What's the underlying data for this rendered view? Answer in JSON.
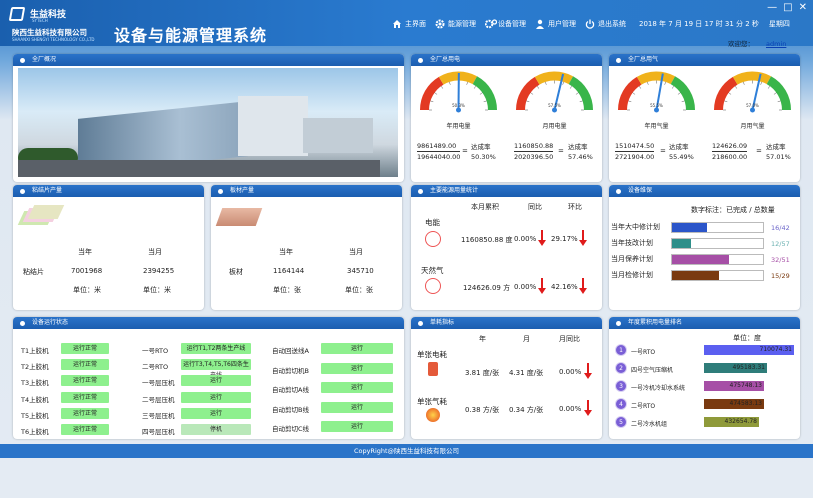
{
  "header": {
    "brand": "生益科技",
    "brand_en": "SYTECH",
    "company": "陕西生益科技有限公司",
    "company_en": "SHAANXI SHENGYI TECHNOLOGY CO.,LTD",
    "system_title": "设备与能源管理系统",
    "nav": [
      {
        "label": "主界面",
        "icon": "home-icon"
      },
      {
        "label": "能源管理",
        "icon": "gear-icon"
      },
      {
        "label": "设备管理",
        "icon": "gears-icon"
      },
      {
        "label": "用户管理",
        "icon": "user-icon"
      },
      {
        "label": "退出系统",
        "icon": "power-icon"
      }
    ],
    "datetime": "2018 年 7 月 19 日  17 时 31 分 2 秒",
    "weekday": "星期四",
    "welcome_label": "欢迎您：",
    "username": "admin",
    "window_controls": [
      "—",
      "□",
      "✕"
    ]
  },
  "overview": {
    "title": "全厂概况"
  },
  "electricity": {
    "title": "全厂总用电",
    "gauges": [
      {
        "label": "年用电量",
        "value_text": "50.3%",
        "percent": 50.3
      },
      {
        "label": "月用电量",
        "value_text": "57.5%",
        "percent": 57.46
      }
    ],
    "stats": [
      {
        "actual": "9861489.00",
        "plan": "19644040.00",
        "rate_label": "达成率",
        "rate": "50.30%"
      },
      {
        "actual": "1160850.88",
        "plan": "2020396.50",
        "rate_label": "达成率",
        "rate": "57.46%"
      }
    ]
  },
  "gas": {
    "title": "全厂总用气",
    "gauges": [
      {
        "label": "年用气量",
        "value_text": "55.5%",
        "percent": 55.49
      },
      {
        "label": "月用气量",
        "value_text": "57.0%",
        "percent": 57.01
      }
    ],
    "stats": [
      {
        "actual": "1510474.50",
        "plan": "2721904.00",
        "rate_label": "达成率",
        "rate": "55.49%"
      },
      {
        "actual": "124626.09",
        "plan": "218600.00",
        "rate_label": "达成率",
        "rate": "57.01%"
      }
    ]
  },
  "prepreg": {
    "title": "粘结片产量",
    "col_current": "当年",
    "col_month": "当月",
    "name": "粘结片",
    "year_value": "7001968",
    "month_value": "2394255",
    "unit_label": "单位：米"
  },
  "laminate": {
    "title": "板材产量",
    "col_current": "当年",
    "col_month": "当月",
    "name": "板材",
    "year_value": "1164144",
    "month_value": "345710",
    "unit_label": "单位：张"
  },
  "energy_stats": {
    "title": "主要能源用量统计",
    "headers": [
      "本月累积",
      "同比",
      "环比"
    ],
    "rows": [
      {
        "name": "电能",
        "value": "1160850.88 度",
        "yoy": "0.00%",
        "mom": "29.17%"
      },
      {
        "name": "天然气",
        "value": "124626.09 方",
        "yoy": "0.00%",
        "mom": "42.16%"
      }
    ]
  },
  "maintenance": {
    "title": "设备维保",
    "subtitle": "数字标注：已完成 / 总数量",
    "items": [
      {
        "label": "当年大中修计划",
        "text": "16/42",
        "fraction": 0.381,
        "color": "#2b55c9",
        "text_color": "#6a64c9"
      },
      {
        "label": "当年技改计划",
        "text": "12/57",
        "fraction": 0.211,
        "color": "#2f8f8a",
        "text_color": "#6ab0b0"
      },
      {
        "label": "当月保养计划",
        "text": "32/51",
        "fraction": 0.627,
        "color": "#a64fa6",
        "text_color": "#a64fa6"
      },
      {
        "label": "当月检修计划",
        "text": "15/29",
        "fraction": 0.517,
        "color": "#7a3a10",
        "text_color": "#7a3a10"
      }
    ]
  },
  "equipment_status": {
    "title": "设备运行状态",
    "col1": [
      {
        "name": "T1上胶机",
        "status": "运行正常"
      },
      {
        "name": "T2上胶机",
        "status": "运行正常"
      },
      {
        "name": "T3上胶机",
        "status": "运行正常"
      },
      {
        "name": "T4上胶机",
        "status": "运行正常"
      },
      {
        "name": "T5上胶机",
        "status": "运行正常"
      },
      {
        "name": "T6上胶机",
        "status": "运行正常"
      }
    ],
    "col2": [
      {
        "name": "一号RTO",
        "status": "运行T1,T2两条生产线"
      },
      {
        "name": "二号RTO",
        "status": "运行T3,T4,T5,T6四条生产线"
      },
      {
        "name": "一号层压机",
        "status": "运行"
      },
      {
        "name": "二号层压机",
        "status": "运行"
      },
      {
        "name": "三号层压机",
        "status": "运行"
      },
      {
        "name": "四号层压机",
        "status": "停机"
      }
    ],
    "col3": [
      {
        "name": "自动回送线A",
        "status": "运行"
      },
      {
        "name": "自动剪切机B",
        "status": "运行"
      },
      {
        "name": "自动剪切A线",
        "status": "运行"
      },
      {
        "name": "自动剪切B线",
        "status": "运行"
      },
      {
        "name": "自动剪切C线",
        "status": "运行"
      }
    ]
  },
  "unit_consumption": {
    "title": "单耗指标",
    "headers": [
      "年",
      "月",
      "月同比"
    ],
    "rows": [
      {
        "name": "单张电耗",
        "year": "3.81 度/张",
        "month": "4.31 度/张",
        "yoy": "0.00%"
      },
      {
        "name": "单张气耗",
        "year": "0.38 方/张",
        "month": "0.34 方/张",
        "yoy": "0.00%"
      }
    ]
  },
  "ranking": {
    "title": "年度累积用电量排名",
    "unit": "单位：度",
    "items": [
      {
        "rank": "1",
        "name": "一号RTO",
        "value": "710074.31",
        "color": "#5b5ff0",
        "fraction": 1.0
      },
      {
        "rank": "2",
        "name": "四号空气压缩机",
        "value": "495183.31",
        "color": "#2f7d7a",
        "fraction": 0.697
      },
      {
        "rank": "3",
        "name": "一号冷机冷却水系统",
        "value": "475748.13",
        "color": "#a64fa6",
        "fraction": 0.67
      },
      {
        "rank": "4",
        "name": "二号RTO",
        "value": "474583.13",
        "color": "#7a3a10",
        "fraction": 0.668
      },
      {
        "rank": "5",
        "name": "二号冷水机组",
        "value": "432654.78",
        "color": "#8f9a3a",
        "fraction": 0.609
      }
    ]
  },
  "footer": {
    "text": "CopyRight@陕西生益科技有限公司"
  }
}
